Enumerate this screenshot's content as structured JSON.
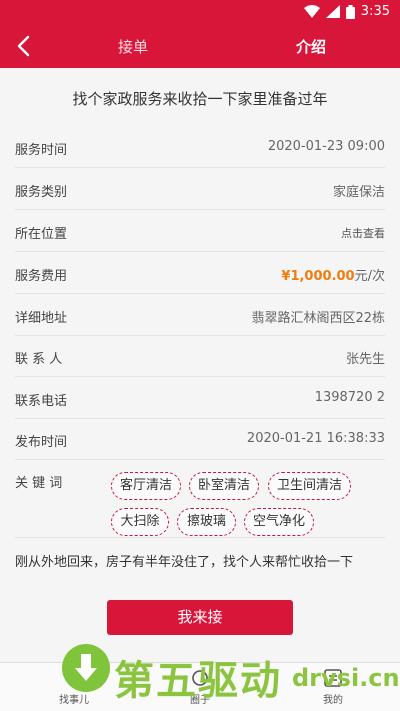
{
  "status": {
    "time": "3:35"
  },
  "header": {
    "tab_order": "接单",
    "tab_intro": "介绍"
  },
  "headline": "找个家政服务来收拾一下家里准备过年",
  "rows": [
    {
      "label": "服务时间",
      "value": "2020-01-23 09:00"
    },
    {
      "label": "服务类别",
      "value": "家庭保洁"
    },
    {
      "label": "所在位置",
      "value": "点击查看"
    },
    {
      "label": "服务费用",
      "price": "¥1,000.00",
      "unit": "元/次"
    },
    {
      "label": "详细地址",
      "value": "翡翠路汇林阁西区22栋"
    },
    {
      "label": "联 系 人",
      "value": "张先生"
    },
    {
      "label": "联系电话",
      "value": "1398720  2"
    },
    {
      "label": "发布时间",
      "value": "2020-01-21 16:38:33"
    }
  ],
  "keywords": {
    "label": "关 键 词",
    "tags": [
      "客厅清洁",
      "卧室清洁",
      "卫生间清洁",
      "大扫除",
      "擦玻璃",
      "空气净化"
    ]
  },
  "description": "刚从外地回来，房子有半年没住了，找个人来帮忙收拾一下",
  "accept_button": "我来接",
  "nav": {
    "find": "找事儿",
    "circle": "圈子",
    "mine": "我的"
  },
  "watermark": {
    "text": "第五驱动",
    "url": "drvsi.cn"
  },
  "colors": {
    "brand": "#d8163a",
    "price": "#f07c0c",
    "watermark": "#8bc53f"
  }
}
